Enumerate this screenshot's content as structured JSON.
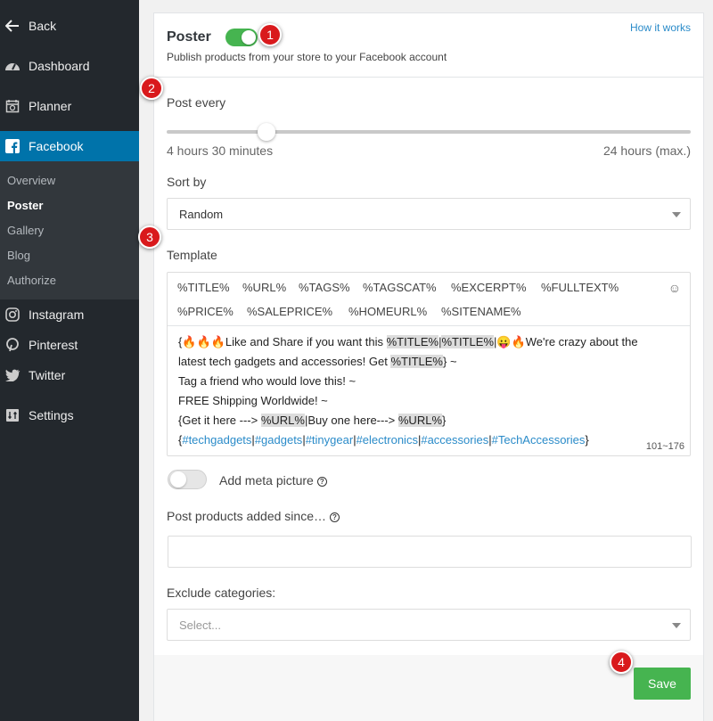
{
  "sidebar": {
    "back": "Back",
    "items": [
      {
        "label": "Dashboard",
        "icon": "dashboard-icon"
      },
      {
        "label": "Planner",
        "icon": "calendar-icon"
      },
      {
        "label": "Facebook",
        "icon": "facebook-icon",
        "active": true
      },
      {
        "label": "Instagram",
        "icon": "instagram-icon"
      },
      {
        "label": "Pinterest",
        "icon": "pinterest-icon"
      },
      {
        "label": "Twitter",
        "icon": "twitter-icon"
      },
      {
        "label": "Settings",
        "icon": "settings-icon"
      }
    ],
    "submenu": [
      "Overview",
      "Poster",
      "Gallery",
      "Blog",
      "Authorize"
    ],
    "current_submenu": "Poster"
  },
  "header": {
    "title": "Poster",
    "subtitle": "Publish products from your store to your Facebook account",
    "how_link": "How it works",
    "enabled": true
  },
  "post_every": {
    "label": "Post every",
    "value_text": "4 hours 30 minutes",
    "max_text": "24 hours (max.)",
    "fraction": 0.19
  },
  "sort_by": {
    "label": "Sort by",
    "value": "Random"
  },
  "template": {
    "label": "Template",
    "tags_row1": [
      "%TITLE%",
      "%URL%",
      "%TAGS%",
      "%TAGSCAT%",
      "%EXCERPT%",
      "%FULLTEXT%"
    ],
    "tags_row2": [
      "%PRICE%",
      "%SALEPRICE%",
      "%HOMEURL%",
      "%SITENAME%"
    ],
    "emoji_button": "☺",
    "line1_a": "Like and Share if you want this ",
    "line1_tag1": "%TITLE%",
    "line1_sep1": "|",
    "line1_tag2": "%TITLE%",
    "line1_sep2": "|",
    "line1_b": "We're crazy about the",
    "line2_a": "latest tech gadgets and accessories! Get ",
    "line2_tag": "%TITLE%",
    "line2_b": "} ~",
    "line3": "Tag a friend who would love this! ~",
    "line4": "FREE Shipping Worldwide! ~",
    "line5_a": "{Get it here ---> ",
    "line5_tag1": "%URL%",
    "line5_b": "|Buy one here---> ",
    "line5_tag2": "%URL%",
    "line5_c": "}",
    "hashtags": [
      "#techgadgets",
      "#gadgets",
      "#tinygear",
      "#electronics",
      "#accessories",
      "#TechAccessories"
    ],
    "counter": "101~176"
  },
  "meta_picture": {
    "label": "Add meta picture",
    "enabled": false
  },
  "post_since": {
    "label": "Post products added since…",
    "value": ""
  },
  "exclude": {
    "label": "Exclude categories:",
    "placeholder": "Select..."
  },
  "footer": {
    "save": "Save"
  },
  "badges": [
    "1",
    "2",
    "3",
    "4"
  ]
}
